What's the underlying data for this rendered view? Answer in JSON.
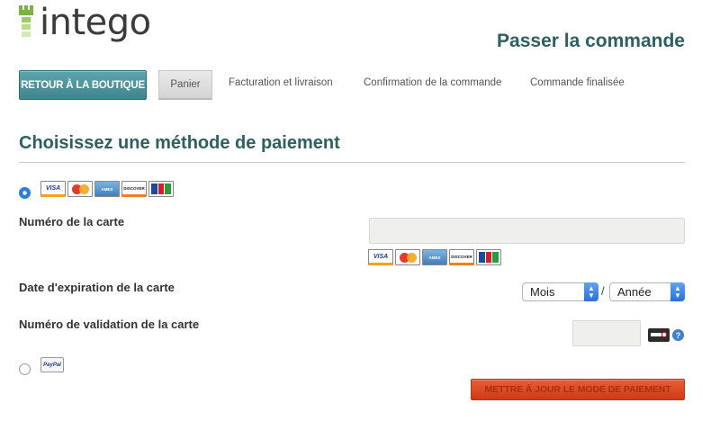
{
  "brand": {
    "name": "intego",
    "color": "#7bb342"
  },
  "header": {
    "title": "Passer la commande"
  },
  "steps": {
    "back_label": "RETOUR À LA BOUTIQUE",
    "items": [
      {
        "label": "Panier",
        "active": true
      },
      {
        "label": "Facturation et livraison",
        "active": false
      },
      {
        "label": "Confirmation de la commande",
        "active": false
      },
      {
        "label": "Commande finalisée",
        "active": false
      }
    ]
  },
  "payment": {
    "title": "Choisissez une méthode de paiement",
    "card_brands": [
      "VISA",
      "MasterCard",
      "AMERICAN EXPRESS",
      "DISCOVER",
      "JCB"
    ],
    "card_option_selected": true,
    "card_number_label": "Numéro de la carte",
    "card_number_value": "",
    "expiration_label": "Date d'expiration de la carte",
    "month_select": "Mois",
    "year_select": "Année",
    "separator": "/",
    "cvv_label": "Numéro de validation de la carte",
    "cvv_value": "",
    "paypal_label": "PayPal",
    "paypal_selected": false,
    "update_button": "METTRE À JOUR LE MODE DE PAIEMENT"
  },
  "colors": {
    "heading": "#2e5f63",
    "back_button": "#4a929b",
    "update_button": "#dc4a23",
    "radio_selected": "#2a7de1"
  }
}
